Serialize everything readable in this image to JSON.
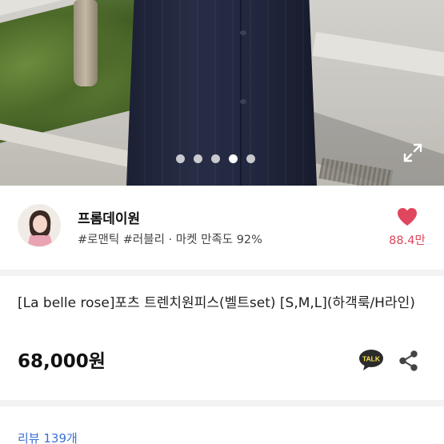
{
  "carousel": {
    "total_slides": 5,
    "active_index": 3,
    "expand_icon": "expand-icon"
  },
  "seller": {
    "name": "프롬데이원",
    "tags": "#로맨틱 #러블리 · 마켓 만족도 92%",
    "like_count": "88.4만",
    "heart_color": "#e0465d"
  },
  "product": {
    "title": "[La belle rose]포츠 트렌치원피스(벨트set) [S,M,L](하객룩/H라인)",
    "price": "68,000원",
    "talk_icon_label": "TALK",
    "share_icon": "share-icon"
  },
  "review": {
    "label": "리뷰 139개"
  },
  "colors": {
    "accent_red": "#e0465d",
    "link_blue": "#3a6fd6",
    "talk_yellow": "#2b2b2b"
  }
}
